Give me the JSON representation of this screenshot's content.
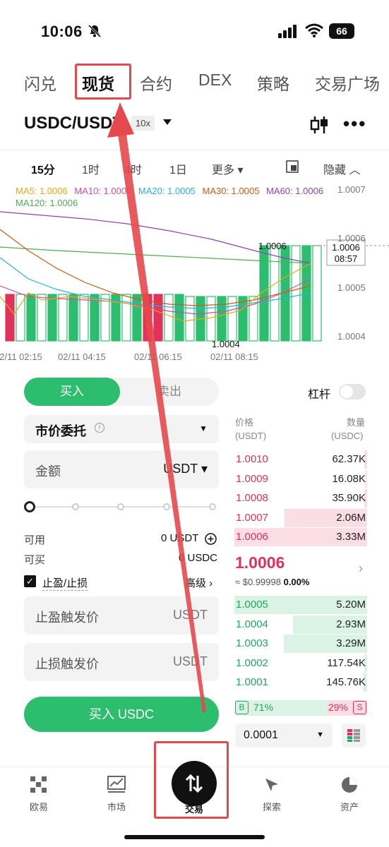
{
  "status_bar": {
    "time": "10:06",
    "battery": "66"
  },
  "top_tabs": [
    "闪兑",
    "现货",
    "合约",
    "DEX",
    "策略",
    "交易广场"
  ],
  "pair": {
    "name": "USDC/USDT",
    "leverage": "10x"
  },
  "intervals": [
    "15分",
    "1时",
    "4时",
    "1日",
    "更多",
    "隐藏"
  ],
  "chart": {
    "ma_legend": [
      {
        "label": "MA5: 1.0006",
        "color": "#e6a817"
      },
      {
        "label": "MA10: 1.0005",
        "color": "#d14fa0"
      },
      {
        "label": "MA20: 1.0005",
        "color": "#2ab4d6"
      },
      {
        "label": "MA30: 1.0005",
        "color": "#d25a12"
      },
      {
        "label": "MA60: 1.0006",
        "color": "#8e44ad"
      },
      {
        "label": "MA120: 1.0006",
        "color": "#4caf50"
      }
    ],
    "y_ticks": [
      "1.0007",
      "1.0006",
      "1.0005",
      "1.0004"
    ],
    "x_ticks": [
      "02/11 02:15",
      "02/11 04:15",
      "02/11 06:15",
      "02/11 08:15"
    ],
    "high_label": "1.0006",
    "low_label": "1.0004",
    "last_price": "1.0006",
    "countdown": "08:57"
  },
  "order_form": {
    "buy": "买入",
    "sell": "卖出",
    "leverage_label": "杠杆",
    "order_type": "市价委托",
    "amount_label": "金额",
    "amount_unit": "USDT",
    "available_label": "可用",
    "available_value": "0 USDT",
    "buyable_label": "可买",
    "buyable_value": "0 USDC",
    "tpsl_label": "止盈/止损",
    "advanced_label": "高级 ›",
    "tp_label": "止盈触发价",
    "tp_unit": "USDT",
    "sl_label": "止损触发价",
    "sl_unit": "USDT",
    "submit": "买入 USDC"
  },
  "order_book": {
    "price_header": "价格",
    "price_unit": "(USDT)",
    "qty_header": "数量",
    "qty_unit": "(USDC)",
    "asks": [
      {
        "price": "1.0010",
        "qty": "62.37K",
        "depth": 0.02
      },
      {
        "price": "1.0009",
        "qty": "16.08K",
        "depth": 0.01
      },
      {
        "price": "1.0008",
        "qty": "35.90K",
        "depth": 0.02
      },
      {
        "price": "1.0007",
        "qty": "2.06M",
        "depth": 0.62
      },
      {
        "price": "1.0006",
        "qty": "3.33M",
        "depth": 1.0
      }
    ],
    "mid_price": "1.0006",
    "mid_sub": "≈ $0.99998",
    "mid_change": "0.00%",
    "bids": [
      {
        "price": "1.0005",
        "qty": "5.20M",
        "depth": 1.0
      },
      {
        "price": "1.0004",
        "qty": "2.93M",
        "depth": 0.56
      },
      {
        "price": "1.0003",
        "qty": "3.29M",
        "depth": 0.63
      },
      {
        "price": "1.0002",
        "qty": "117.54K",
        "depth": 0.02
      },
      {
        "price": "1.0001",
        "qty": "145.76K",
        "depth": 0.03
      }
    ],
    "buy_ratio_label": "B",
    "buy_ratio": "71%",
    "sell_ratio": "29%",
    "sell_ratio_label": "S",
    "tick_size": "0.0001"
  },
  "bottom_nav": [
    "欧易",
    "市场",
    "交易",
    "探索",
    "资产"
  ]
}
